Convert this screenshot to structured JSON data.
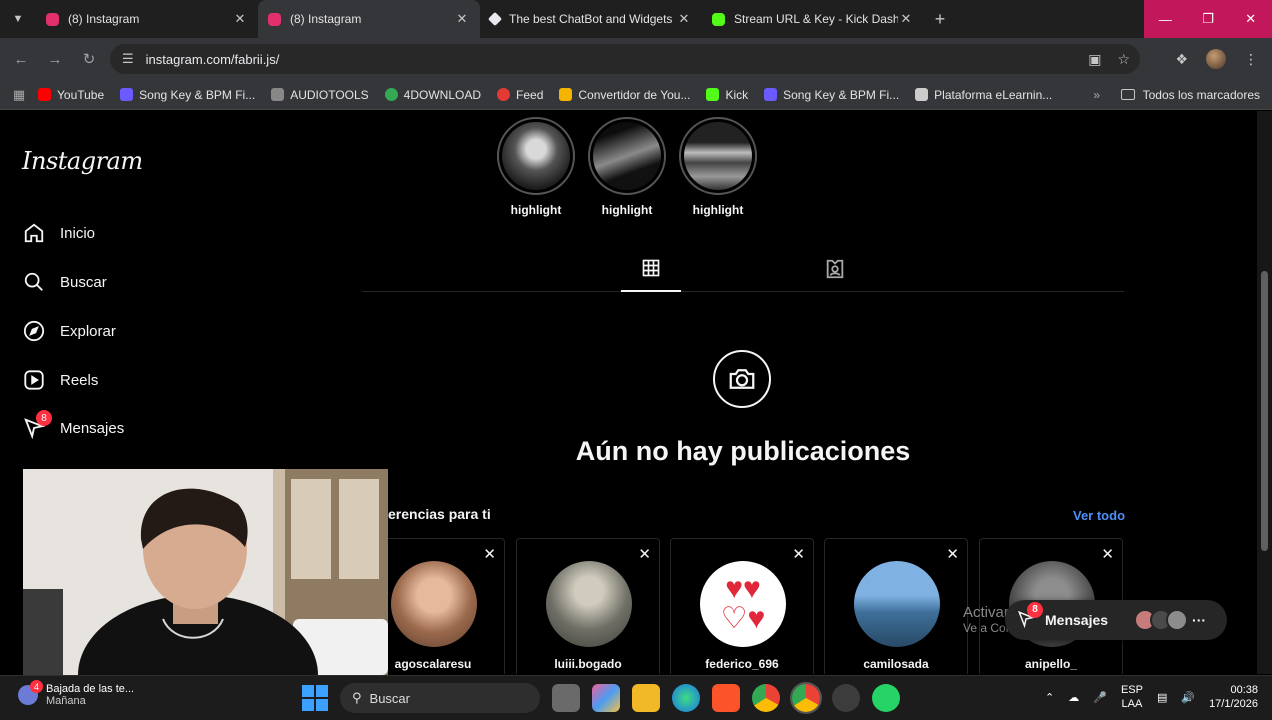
{
  "browser": {
    "tabs": [
      {
        "title": "(8) Instagram",
        "active": false,
        "favicon_color": "#e1306c"
      },
      {
        "title": "(8) Instagram",
        "active": true,
        "favicon_color": "#e1306c"
      },
      {
        "title": "The best ChatBot and Widgets",
        "active": false,
        "favicon_color": "#e8eaed"
      },
      {
        "title": "Stream URL & Key - Kick Dashb",
        "active": false,
        "favicon_color": "#53fc18"
      }
    ],
    "url": "instagram.com/fabrii.js/",
    "bookmarks": [
      {
        "label": "YouTube",
        "color": "#ff0000"
      },
      {
        "label": "Song Key & BPM Fi...",
        "color": "#6b5bff"
      },
      {
        "label": "AUDIOTOOLS",
        "color": "#888888"
      },
      {
        "label": "4DOWNLOAD",
        "color": "#34a853"
      },
      {
        "label": "Feed",
        "color": "#e53935"
      },
      {
        "label": "Convertidor de You...",
        "color": "#f4b400"
      },
      {
        "label": "Kick",
        "color": "#53fc18"
      },
      {
        "label": "Song Key & BPM Fi...",
        "color": "#6b5bff"
      },
      {
        "label": "Plataforma eLearnin...",
        "color": "#cccccc"
      }
    ],
    "all_bookmarks": "Todos los marcadores",
    "window_color": "#c2185b"
  },
  "instagram": {
    "logo": "Instagram",
    "nav": [
      {
        "label": "Inicio",
        "icon": "home-icon"
      },
      {
        "label": "Buscar",
        "icon": "search-icon"
      },
      {
        "label": "Explorar",
        "icon": "compass-icon"
      },
      {
        "label": "Reels",
        "icon": "reels-icon"
      },
      {
        "label": "Mensajes",
        "icon": "messenger-icon",
        "badge": "8"
      }
    ],
    "highlights": [
      {
        "label": "highlight"
      },
      {
        "label": "highlight"
      },
      {
        "label": "highlight"
      }
    ],
    "empty_title": "Aún no hay publicaciones",
    "suggestions_title": "erencias para ti",
    "see_all": "Ver todo",
    "suggestions": [
      {
        "username": "agoscalaresu",
        "color": "#c48d6e"
      },
      {
        "username": "luiii.bogado",
        "color": "#7b7d74"
      },
      {
        "username": "federico_696",
        "color": "#ffffff"
      },
      {
        "username": "camilosada",
        "color": "#4f86b8"
      },
      {
        "username": "anipello_",
        "color": "#6d6d6d"
      }
    ],
    "messages_pill": {
      "label": "Mensajes",
      "badge": "8"
    },
    "accent": "#4f8ef7"
  },
  "watermark": {
    "title": "Activar Windows",
    "subtitle": "Ve a Configuración para activar Windows."
  },
  "taskbar": {
    "weather_title": "Bajada de las te...",
    "weather_sub": "Mañana",
    "weather_badge": "4",
    "search_placeholder": "Buscar",
    "lang_top": "ESP",
    "lang_bottom": "LAA",
    "time": "00:38",
    "date": "17/1/2026"
  }
}
